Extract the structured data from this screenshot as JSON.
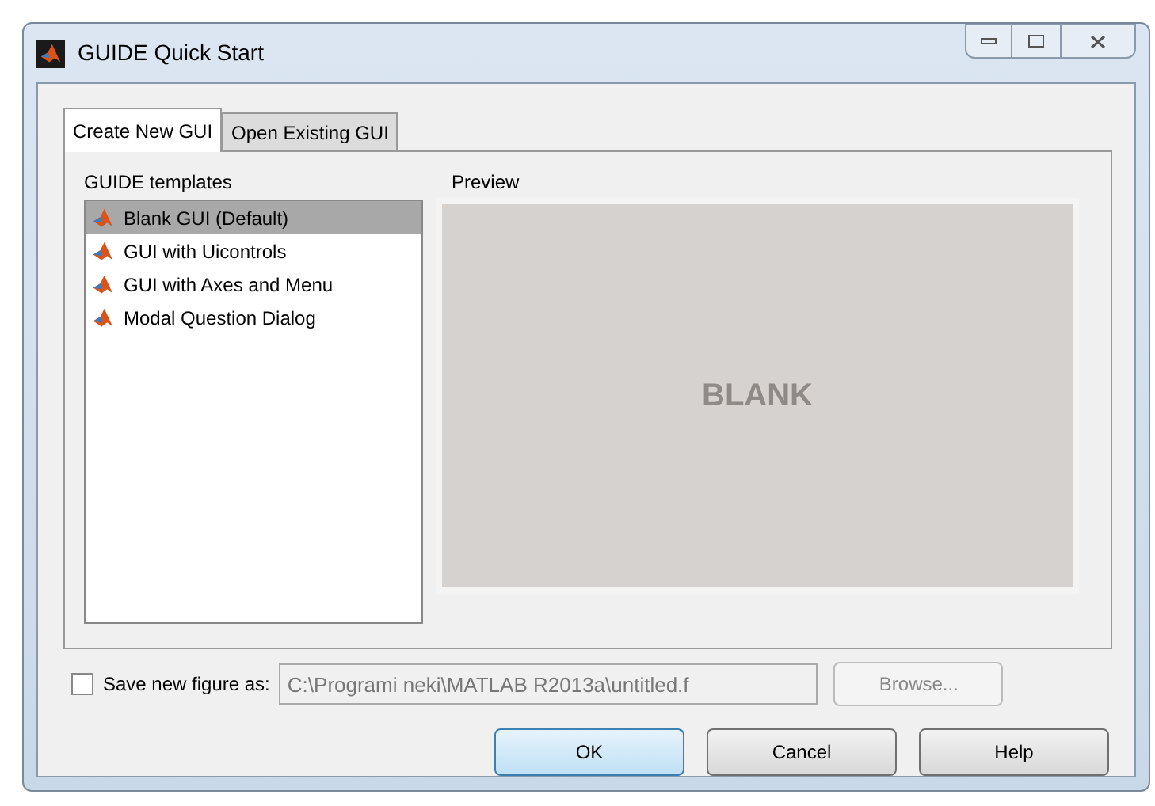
{
  "window": {
    "title": "GUIDE Quick Start"
  },
  "tabs": [
    {
      "label": "Create New GUI",
      "selected": true
    },
    {
      "label": "Open Existing GUI",
      "selected": false
    }
  ],
  "templates": {
    "label": "GUIDE templates",
    "items": [
      {
        "label": "Blank GUI (Default)",
        "selected": true
      },
      {
        "label": "GUI with Uicontrols",
        "selected": false
      },
      {
        "label": "GUI with Axes and Menu",
        "selected": false
      },
      {
        "label": "Modal Question Dialog",
        "selected": false
      }
    ]
  },
  "preview": {
    "label": "Preview",
    "text": "BLANK"
  },
  "save": {
    "label": "Save new figure as:",
    "checked": false,
    "value": "C:\\Programi neki\\MATLAB R2013a\\untitled.f",
    "disabled": true,
    "browse": "Browse..."
  },
  "buttons": [
    {
      "label": "OK",
      "default": true
    },
    {
      "label": "Cancel",
      "default": false
    },
    {
      "label": "Help",
      "default": false
    }
  ]
}
